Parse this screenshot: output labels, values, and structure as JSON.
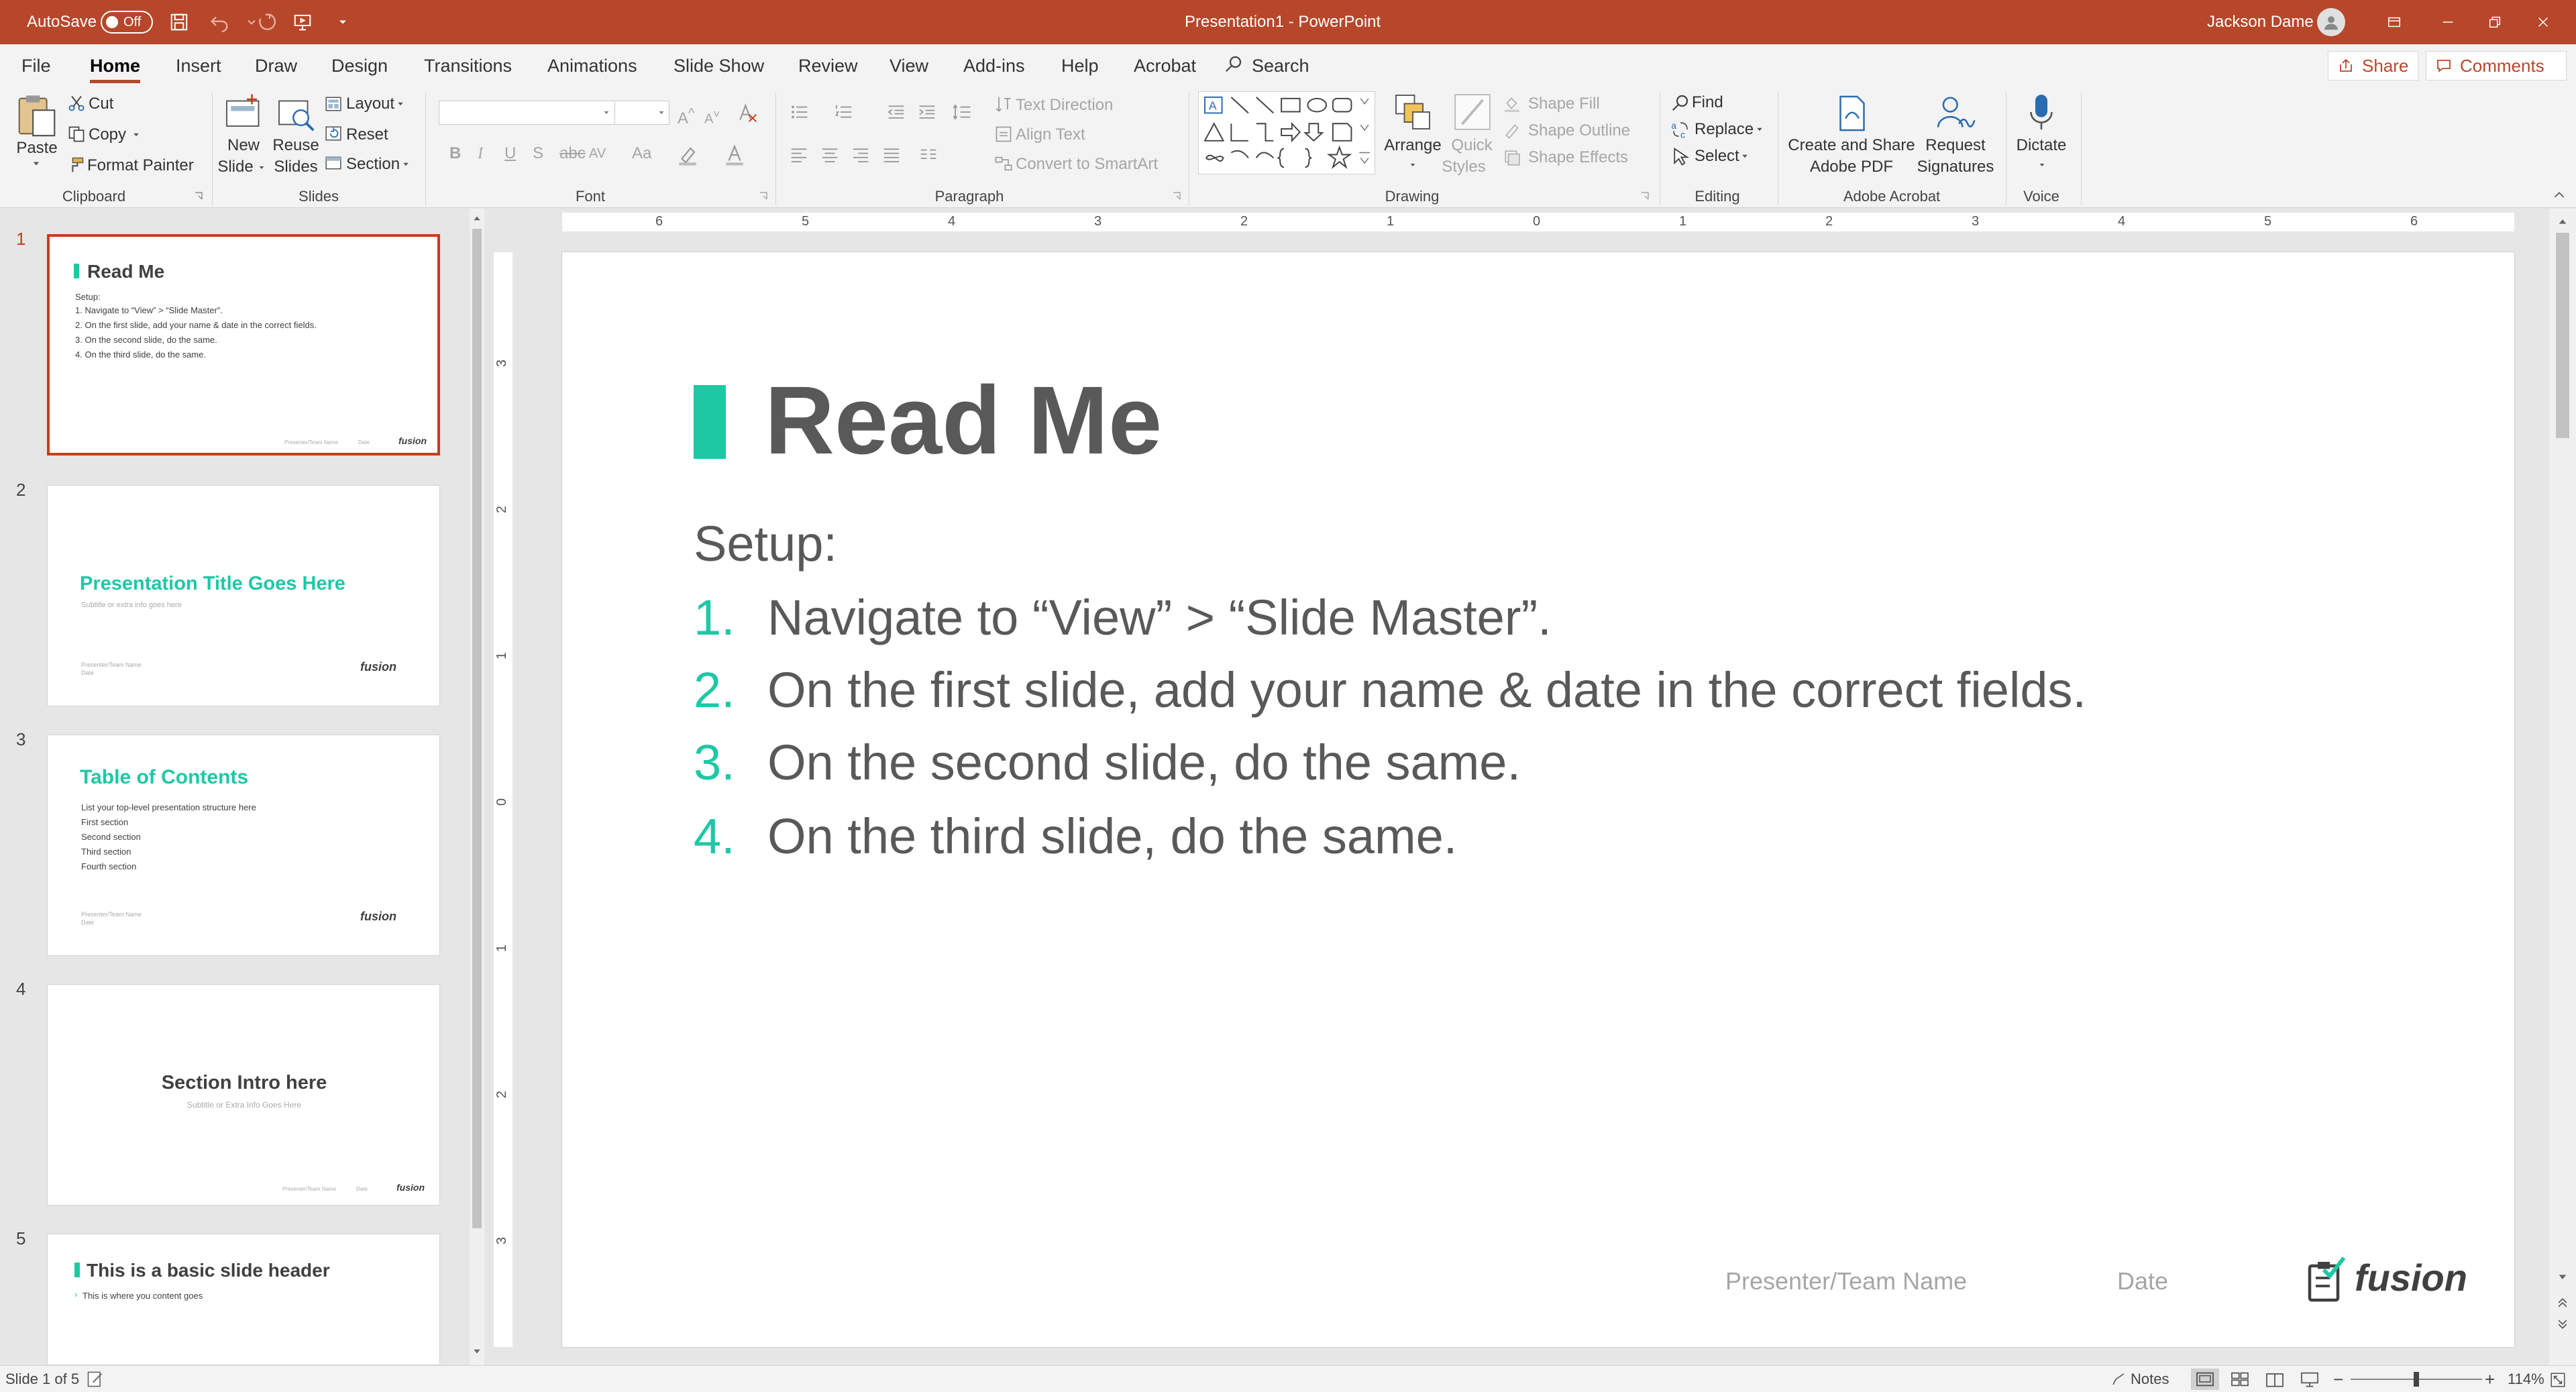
{
  "titlebar": {
    "autosave_label": "AutoSave",
    "autosave_state": "Off",
    "doc_title": "Presentation1  -  PowerPoint",
    "user_name": "Jackson Dame"
  },
  "tabs": [
    "File",
    "Home",
    "Insert",
    "Draw",
    "Design",
    "Transitions",
    "Animations",
    "Slide Show",
    "Review",
    "View",
    "Add-ins",
    "Help",
    "Acrobat"
  ],
  "active_tab": "Home",
  "search_label": "Search",
  "share_label": "Share",
  "comments_label": "Comments",
  "ribbon": {
    "clipboard": {
      "paste": "Paste",
      "cut": "Cut",
      "copy": "Copy",
      "format_painter": "Format Painter",
      "group": "Clipboard"
    },
    "slides": {
      "new_slide_1": "New",
      "new_slide_2": "Slide",
      "reuse_1": "Reuse",
      "reuse_2": "Slides",
      "layout": "Layout",
      "reset": "Reset",
      "section": "Section",
      "group": "Slides"
    },
    "font": {
      "group": "Font"
    },
    "paragraph": {
      "text_direction": "Text Direction",
      "align_text": "Align Text",
      "convert_smartart": "Convert to SmartArt",
      "group": "Paragraph"
    },
    "drawing": {
      "arrange": "Arrange",
      "quick_1": "Quick",
      "quick_2": "Styles",
      "shape_fill": "Shape Fill",
      "shape_outline": "Shape Outline",
      "shape_effects": "Shape Effects",
      "group": "Drawing"
    },
    "editing": {
      "find": "Find",
      "replace": "Replace",
      "select": "Select",
      "group": "Editing"
    },
    "acrobat": {
      "create_1": "Create and Share",
      "create_2": "Adobe PDF",
      "request_1": "Request",
      "request_2": "Signatures",
      "group": "Adobe Acrobat"
    },
    "voice": {
      "dictate": "Dictate",
      "group": "Voice"
    }
  },
  "thumbnails": [
    {
      "num": "1",
      "title": "Read Me",
      "setup": "Setup:",
      "items": [
        "1.   Navigate to “View” > “Slide Master”.",
        "2.   On the first slide, add your name & date in the correct fields.",
        "3.   On the second slide, do the same.",
        "4.   On the third slide, do the same."
      ],
      "footer": "Presenter/Team Name",
      "date": "Date",
      "logo": "fusion"
    },
    {
      "num": "2",
      "title": "Presentation Title Goes Here",
      "subtitle": "Subtitle or extra info goes here",
      "footer": "Presenter/Team Name",
      "date": "Date",
      "logo": "fusion"
    },
    {
      "num": "3",
      "title": "Table of Contents",
      "items": [
        "List your top-level presentation structure here",
        "First section",
        "Second section",
        "Third section",
        "Fourth section"
      ],
      "footer": "Presenter/Team Name",
      "date": "Date",
      "logo": "fusion"
    },
    {
      "num": "4",
      "title": "Section Intro here",
      "subtitle": "Subtitle or Extra Info Goes Here",
      "footer": "Presenter/Team Name",
      "date": "Date",
      "logo": "fusion"
    },
    {
      "num": "5",
      "title": "This is a basic slide header",
      "bullet": "This is where you content goes"
    }
  ],
  "slide": {
    "title": "Read Me",
    "setup": "Setup:",
    "items": [
      {
        "n": "1.",
        "text": "Navigate to “View” > “Slide Master”."
      },
      {
        "n": "2.",
        "text": "On the first slide, add your name & date in the correct fields."
      },
      {
        "n": "3.",
        "text": "On the second slide, do the same."
      },
      {
        "n": "4.",
        "text": "On the third slide, do the same."
      }
    ],
    "presenter": "Presenter/Team Name",
    "date": "Date",
    "logo": "fusion"
  },
  "ruler": {
    "h": [
      "6",
      "5",
      "4",
      "3",
      "2",
      "1",
      "0",
      "1",
      "2",
      "3",
      "4",
      "5",
      "6"
    ],
    "v": [
      "3",
      "2",
      "1",
      "0",
      "1",
      "2",
      "3"
    ]
  },
  "status": {
    "slide_count": "Slide 1 of 5",
    "notes": "Notes",
    "zoom": "114%"
  },
  "colors": {
    "brand": "#b7472a",
    "accent": "#1ec8a5",
    "text": "#595959"
  }
}
